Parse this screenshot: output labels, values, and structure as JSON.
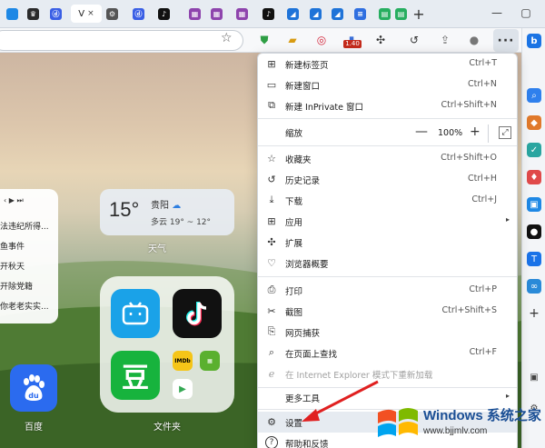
{
  "tabs": {
    "active_label": "V",
    "close_glyph": "×",
    "favicons": [
      {
        "icon": "tab-generic-icon",
        "color": "#1e88e5",
        "glyph": ""
      },
      {
        "icon": "tab-crown-icon",
        "color": "#2b2b2b",
        "glyph": "♛"
      },
      {
        "icon": "tab-baidu-icon",
        "color": "#3a5fe5",
        "glyph": "ⓓ"
      },
      {
        "icon": "tab-settings-icon",
        "color": "#555555",
        "glyph": "⚙"
      },
      {
        "icon": "tab-baidu-icon",
        "color": "#3a5fe5",
        "glyph": "ⓓ"
      },
      {
        "icon": "tab-tiktok-icon",
        "color": "#111111",
        "glyph": "♪"
      },
      {
        "icon": "tab-grid-icon",
        "color": "#8e44ad",
        "glyph": "▦"
      },
      {
        "icon": "tab-grid-icon",
        "color": "#8e44ad",
        "glyph": "▦"
      },
      {
        "icon": "tab-grid-icon",
        "color": "#8e44ad",
        "glyph": "▦"
      },
      {
        "icon": "tab-tiktok-icon",
        "color": "#111111",
        "glyph": "♪"
      },
      {
        "icon": "tab-chart-icon",
        "color": "#1e73d8",
        "glyph": "◢"
      },
      {
        "icon": "tab-chart-icon",
        "color": "#1e73d8",
        "glyph": "◢"
      },
      {
        "icon": "tab-chart-icon",
        "color": "#1e73d8",
        "glyph": "◢"
      },
      {
        "icon": "tab-doc-icon",
        "color": "#2f6fe0",
        "glyph": "≡"
      },
      {
        "icon": "tab-sheet-icon",
        "color": "#27ae60",
        "glyph": "▤"
      },
      {
        "icon": "tab-sheet-icon",
        "color": "#27ae60",
        "glyph": "▤"
      }
    ],
    "new_tab_glyph": "+"
  },
  "window": {
    "minimize": "—",
    "restore": "▢"
  },
  "toolbar": {
    "favorite_glyph": "☆",
    "more_glyph": "···",
    "badge_text": "1.40"
  },
  "menu": {
    "items": [
      {
        "name": "menu-item-new-tab",
        "icon": "new-tab-icon",
        "glyph": "⊞",
        "label": "新建标签页",
        "shortcut": "Ctrl+T"
      },
      {
        "name": "menu-item-new-window",
        "icon": "new-window-icon",
        "glyph": "▭",
        "label": "新建窗口",
        "shortcut": "Ctrl+N"
      },
      {
        "name": "menu-item-new-inprivate",
        "icon": "inprivate-icon",
        "glyph": "⧉",
        "label": "新建 InPrivate 窗口",
        "shortcut": "Ctrl+Shift+N"
      },
      {
        "name": "menu-item-favorites",
        "icon": "favorites-icon",
        "glyph": "☆",
        "label": "收藏夹",
        "shortcut": "Ctrl+Shift+O"
      },
      {
        "name": "menu-item-history",
        "icon": "history-icon",
        "glyph": "↺",
        "label": "历史记录",
        "shortcut": "Ctrl+H"
      },
      {
        "name": "menu-item-downloads",
        "icon": "download-icon",
        "glyph": "⤓",
        "label": "下载",
        "shortcut": "Ctrl+J"
      },
      {
        "name": "menu-item-apps",
        "icon": "apps-icon",
        "glyph": "⊞",
        "label": "应用",
        "shortcut": "",
        "submenu": true
      },
      {
        "name": "menu-item-extensions",
        "icon": "extensions-icon",
        "glyph": "✣",
        "label": "扩展",
        "shortcut": ""
      },
      {
        "name": "menu-item-browser-essentials",
        "icon": "heart-pulse-icon",
        "glyph": "♡",
        "label": "浏览器概要",
        "shortcut": ""
      },
      {
        "name": "menu-item-print",
        "icon": "print-icon",
        "glyph": "⎙",
        "label": "打印",
        "shortcut": "Ctrl+P"
      },
      {
        "name": "menu-item-screenshot",
        "icon": "screenshot-icon",
        "glyph": "✂",
        "label": "截图",
        "shortcut": "Ctrl+Shift+S"
      },
      {
        "name": "menu-item-web-capture",
        "icon": "web-capture-icon",
        "glyph": "⎘",
        "label": "网页捕获",
        "shortcut": ""
      },
      {
        "name": "menu-item-find",
        "icon": "find-icon",
        "glyph": "⌕",
        "label": "在页面上查找",
        "shortcut": "Ctrl+F"
      },
      {
        "name": "menu-item-ie-mode",
        "icon": "ie-mode-icon",
        "glyph": "ℯ",
        "label": "在 Internet Explorer 模式下重新加载",
        "shortcut": "",
        "disabled": true
      },
      {
        "name": "menu-item-more-tools",
        "icon": "more-tools-icon",
        "glyph": "",
        "label": "更多工具",
        "shortcut": "",
        "submenu": true
      },
      {
        "name": "menu-item-settings",
        "icon": "gear-icon",
        "glyph": "⚙",
        "label": "设置",
        "shortcut": "",
        "highlight": true
      },
      {
        "name": "menu-item-help",
        "icon": "help-icon",
        "glyph": "?",
        "label": "帮助和反馈",
        "shortcut": ""
      }
    ],
    "zoom": {
      "label": "缩放",
      "minus": "—",
      "value": "100%",
      "plus": "+",
      "fullscreen_glyph": "⤢"
    },
    "submenu_arrow": "▸"
  },
  "newtab": {
    "news": {
      "nav": "‹  ▶  ⏭",
      "lines": [
        "法违纪所得...",
        "鱼事件",
        "开秋天",
        "开除党籍",
        "你老老实实..."
      ]
    },
    "weather": {
      "temp": "15°",
      "city": "贵阳",
      "condition": "多云 19° ~ 12°",
      "label": "天气"
    },
    "folder_label": "文件夹",
    "baidu_label": "百度",
    "mini_apps": [
      "IMDb",
      "▦",
      "▶"
    ]
  },
  "watermark": {
    "title": "Windows 系统之家",
    "url": "www.bjjmlv.com"
  }
}
